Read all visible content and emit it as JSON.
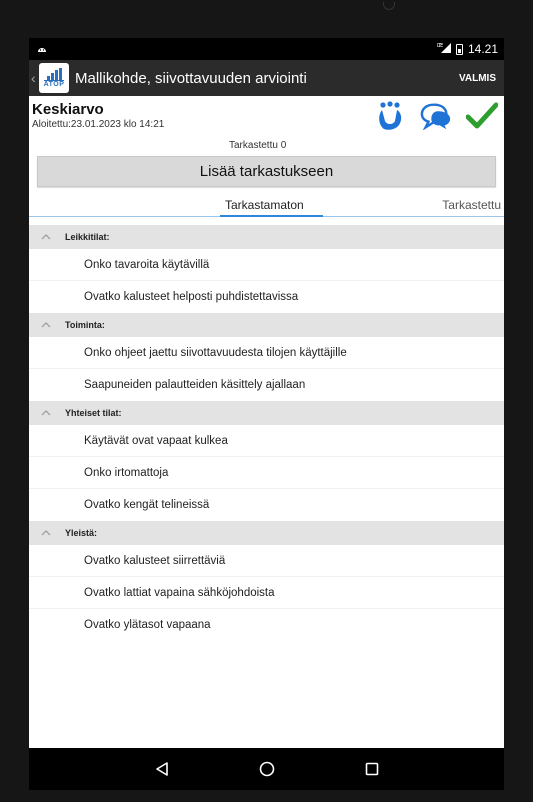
{
  "status_bar": {
    "time": "14.21",
    "network": "LTE"
  },
  "app_bar": {
    "logo_text": "ATOP",
    "title": "Mallikohde, siivottavuuden arviointi",
    "done_label": "VALMIS"
  },
  "header": {
    "title": "Keskiarvo",
    "started": "Aloitettu:23.01.2023 klo 14:21",
    "checked_count": "Tarkastettu 0"
  },
  "add_button": "Lisää tarkastukseen",
  "tabs": {
    "unchecked": "Tarkastamaton",
    "checked": "Tarkastettu"
  },
  "sections": [
    {
      "label": "Leikkitilat:",
      "items": [
        "Onko tavaroita käytävillä",
        "Ovatko kalusteet helposti puhdistettavissa"
      ]
    },
    {
      "label": "Toiminta:",
      "items": [
        "Onko ohjeet jaettu siivottavuudesta tilojen käyttäjille",
        "Saapuneiden palautteiden käsittely ajallaan"
      ]
    },
    {
      "label": "Yhteiset tilat:",
      "items": [
        "Käytävät ovat vapaat kulkea",
        "Onko irtomattoja",
        "Ovatko kengät telineissä"
      ]
    },
    {
      "label": "Yleistä:",
      "items": [
        "Ovatko kalusteet siirrettäviä",
        "Ovatko lattiat vapaina sähköjohdoista",
        "Ovatko ylätasot vapaana"
      ]
    }
  ],
  "colors": {
    "accent": "#2a8ad8",
    "check": "#2e9e2e",
    "app_bar": "#2b2b2b",
    "section_bg": "#e3e3e3"
  },
  "icons": {
    "header": [
      "people-icon",
      "chat-bubble-icon",
      "checkmark-icon"
    ],
    "nav": [
      "back-triangle-icon",
      "home-circle-icon",
      "recents-square-icon"
    ]
  }
}
